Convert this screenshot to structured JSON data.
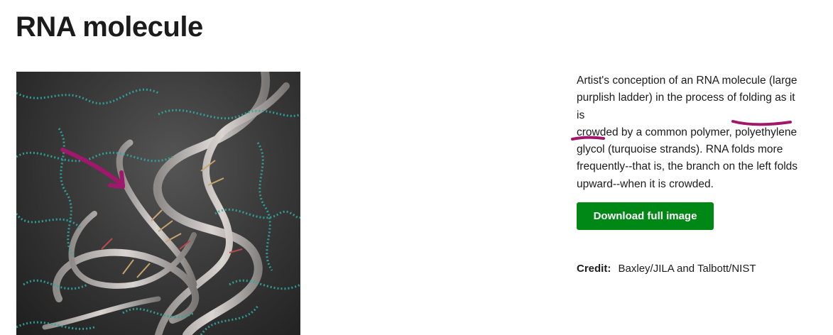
{
  "page": {
    "title": "RNA molecule"
  },
  "image": {
    "icon": "rna-molecule-illustration"
  },
  "description": {
    "line1": "Artist's conception of an RNA molecule (large",
    "line2": "purplish ladder) in the process of folding as it is",
    "line3a": "crowded by a common polymer, ",
    "line3b": "polyethylene",
    "line4a": "glycol",
    "line4b": " (turquoise strands). RNA folds more",
    "line5": "frequently--that is, the branch on the left folds",
    "line6": "upward--when it is crowded."
  },
  "download": {
    "label": "Download full image",
    "color": "#008817"
  },
  "credit": {
    "label": "Credit:",
    "value": "Baxley/JILA and Talbott/NIST"
  },
  "annotations": {
    "ink_color": "#a1176b"
  }
}
